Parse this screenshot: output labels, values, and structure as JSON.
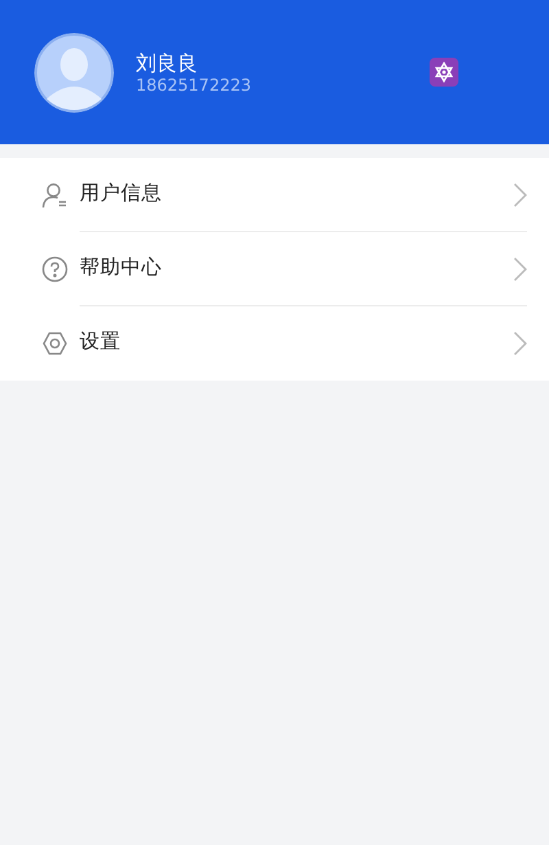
{
  "profile": {
    "name": "刘良良",
    "phone": "18625172223"
  },
  "menu": [
    {
      "kind": "user",
      "label": "用户信息"
    },
    {
      "kind": "help",
      "label": "帮助中心"
    },
    {
      "kind": "settings",
      "label": "设置"
    }
  ]
}
